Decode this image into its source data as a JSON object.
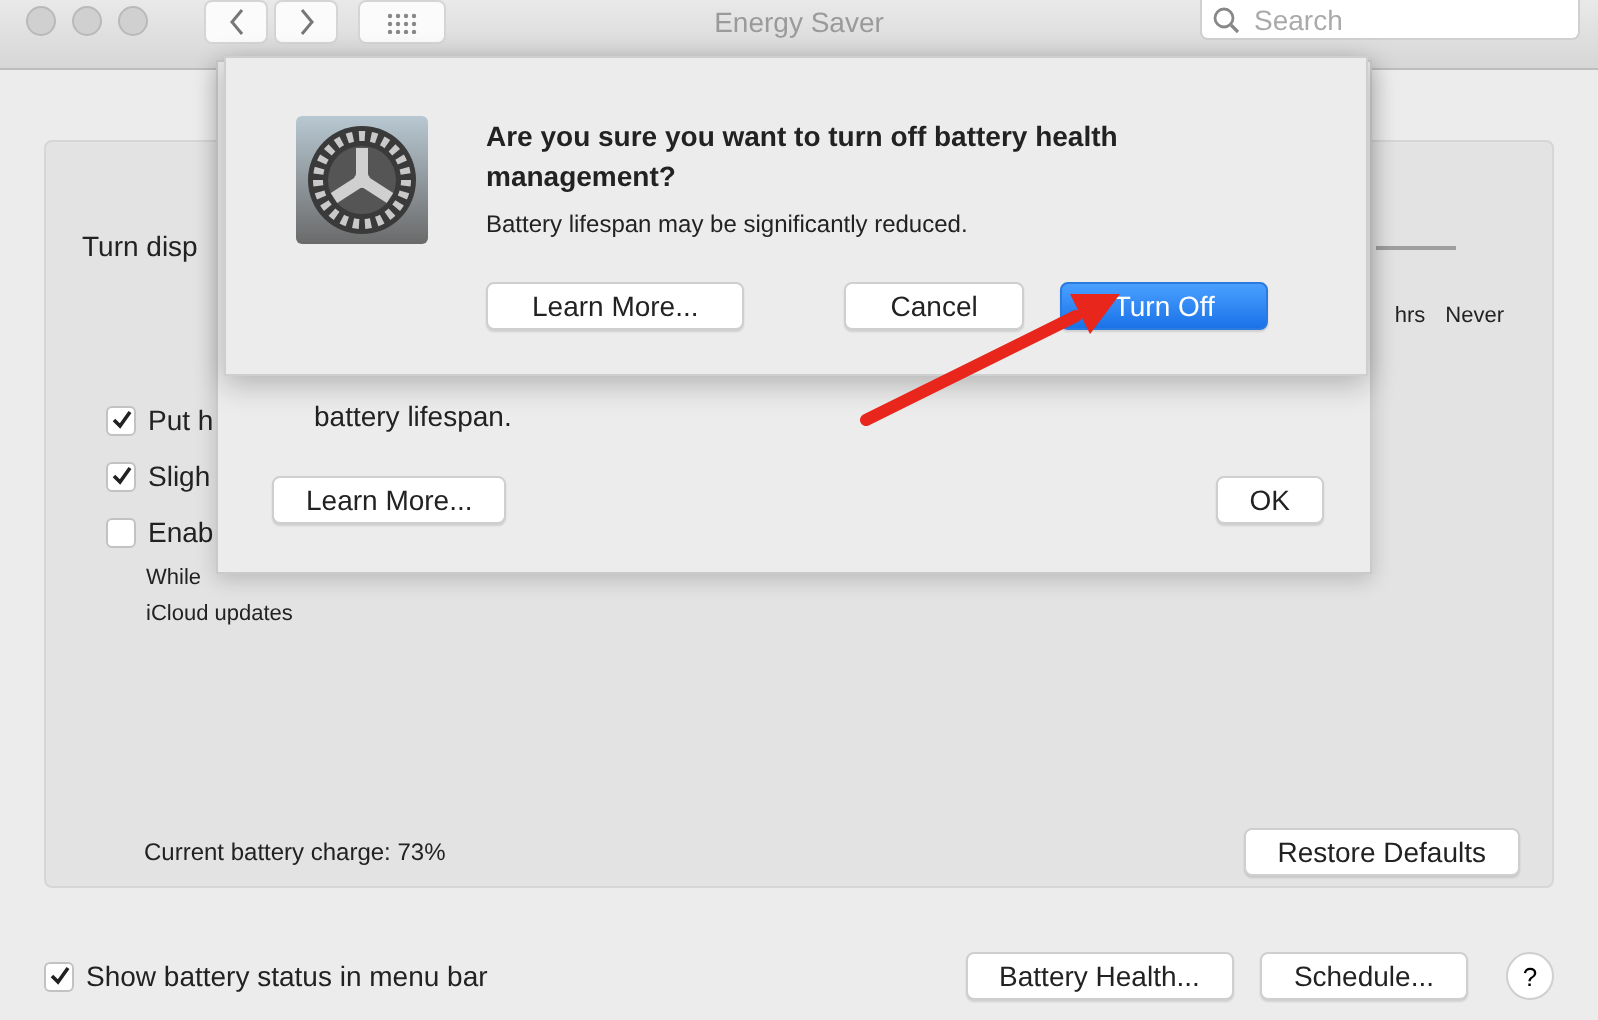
{
  "window": {
    "title": "Energy Saver",
    "search": {
      "placeholder": "Search"
    }
  },
  "settings": {
    "display_off_label": "Turn disp",
    "slider_labels": [
      "hrs",
      "Never"
    ],
    "options": [
      {
        "label": "Put h",
        "checked": true
      },
      {
        "label": "Sligh",
        "checked": true
      },
      {
        "label": "Enab",
        "checked": false,
        "note_lines": [
          "While",
          "iCloud updates"
        ]
      }
    ],
    "battery_charge": "Current battery charge: 73%",
    "restore_button": "Restore Defaults"
  },
  "footer": {
    "show_status": {
      "label": "Show battery status in menu bar",
      "checked": true
    },
    "buttons": [
      "Battery Health...",
      "Schedule..."
    ],
    "help": "?"
  },
  "battery_health_sheet": {
    "text": "battery lifespan.",
    "buttons": [
      "Learn More...",
      "OK"
    ]
  },
  "alert": {
    "title": "Are you sure you want to turn off battery health management?",
    "message": "Battery lifespan may be significantly reduced.",
    "buttons": [
      {
        "label": "Learn More...",
        "default": false
      },
      {
        "label": "Cancel",
        "default": false
      },
      {
        "label": "Turn Off",
        "default": true
      }
    ]
  }
}
